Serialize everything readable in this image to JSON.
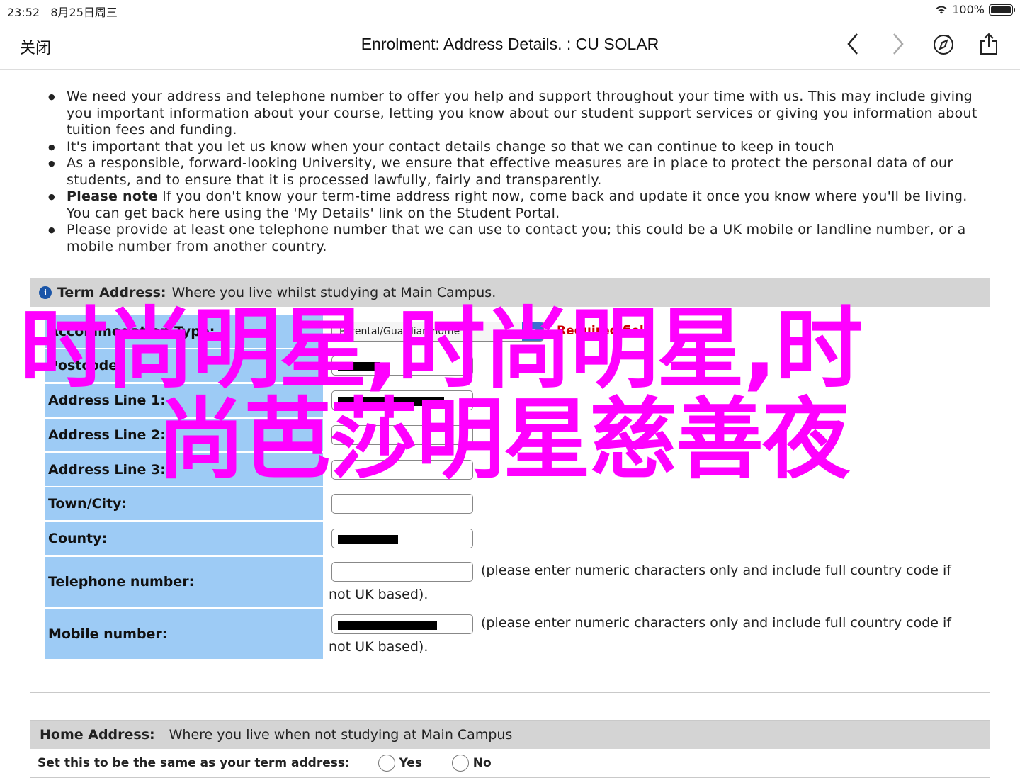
{
  "status": {
    "time": "23:52",
    "date": "8月25日周三",
    "battery": "100%",
    "battery_level": 1.0
  },
  "nav": {
    "close_label": "关闭",
    "title": "Enrolment: Address Details. : CU SOLAR",
    "icons": [
      "back-icon",
      "forward-icon",
      "compass-icon",
      "share-icon"
    ]
  },
  "notes": [
    {
      "bold": "",
      "text": "We need your address and telephone number to offer you help and support throughout your time with us. This may include giving you important information about your course, letting you know about our student support services or giving you information about tuition fees and funding."
    },
    {
      "bold": "",
      "text": "It's important that you let us know when your contact details change so that we can continue to keep in touch"
    },
    {
      "bold": "",
      "text": "As a responsible, forward-looking University, we ensure that effective measures are in place to protect the personal data of our students, and to ensure that it is processed lawfully, fairly and transparently."
    },
    {
      "bold": "Please note",
      "text": " If you don't know your term-time address right now, come back and update it once you know where you'll be living. You can get back here using the 'My Details' link on the Student Portal."
    },
    {
      "bold": "",
      "text": "Please provide at least one telephone number that we can use to contact you; this could be a UK mobile or landline number, or a mobile number from another country."
    }
  ],
  "term": {
    "head_bold": "Term Address:",
    "head_text": "Where you live whilst studying at Main Campus.",
    "accommodation_label": "Accommodation Type:",
    "accommodation_value": "Parental/Guardian home",
    "required_label": "Required field",
    "fields": [
      {
        "label": "Postcode:",
        "value": ""
      },
      {
        "label": "Address Line 1:",
        "value": ""
      },
      {
        "label": "Address Line 2:",
        "value": ""
      },
      {
        "label": "Address Line 3:",
        "value": ""
      },
      {
        "label": "Town/City:",
        "value": ""
      },
      {
        "label": "County:",
        "value": ""
      }
    ],
    "telephone_label": "Telephone number:",
    "mobile_label": "Mobile number:",
    "phone_hint": "(please enter numeric characters only and include full country code if not UK based)."
  },
  "home": {
    "head_bold": "Home Address:",
    "head_text": "Where you live when not studying at Main Campus",
    "same_label": "Set this to be the same as your term address:",
    "yes_label": "Yes",
    "no_label": "No"
  },
  "watermark": {
    "line1": "时尚明星,时尚明星,时",
    "line2": "尚芭莎明星慈善夜",
    "color": "#ff00ff"
  }
}
